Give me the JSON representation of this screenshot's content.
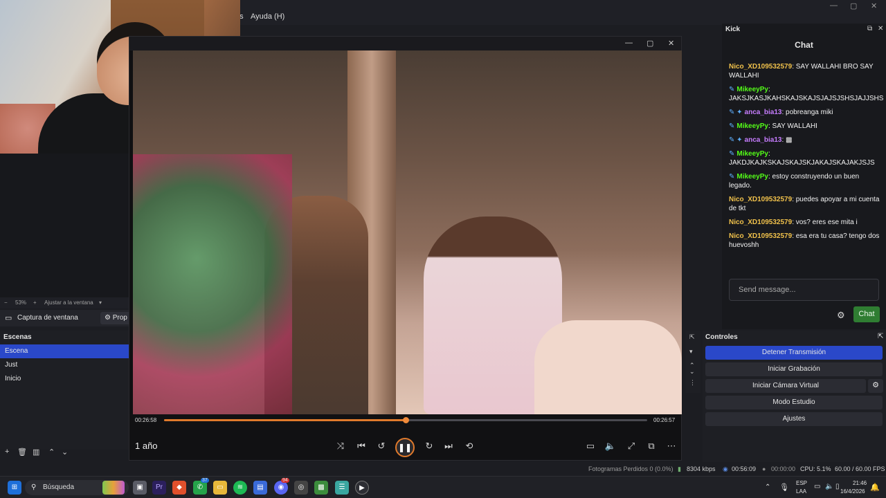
{
  "menubar": {
    "menu_item": "Ayuda (H)",
    "menu_prefix": "as"
  },
  "obs": {
    "zoom": "53%",
    "fit_label": "Ajustar a la ventana",
    "source_label": "Captura de ventana",
    "props_label": "Prop",
    "scenes_header": "Escenas",
    "scenes": [
      "Escena",
      "Just",
      "Inicio"
    ],
    "scene_tools": [
      "+",
      "🗑",
      "▥",
      "⌃",
      "⌄"
    ]
  },
  "player": {
    "time_current": "00:26:58",
    "time_total": "00:26:57",
    "progress": 0.5,
    "age_label": "1 año",
    "controls": [
      "shuffle-icon",
      "previous-icon",
      "rewind-icon",
      "pause-icon",
      "forward-icon",
      "next-icon",
      "repeat-off-icon"
    ],
    "right_controls": [
      "miniplayer-icon",
      "volume-icon",
      "expand-icon",
      "popout-icon",
      "more-icon"
    ]
  },
  "chat": {
    "dock_title": "Kick",
    "title": "Chat",
    "messages": [
      {
        "user": "Nico_XD109532579",
        "color": "#f0c14b",
        "text": "SAY WALLAHI BRO SAY WALLAHI",
        "badges": ""
      },
      {
        "user": "MikeeyPy",
        "color": "#53fc18",
        "text": "JAKSJKASJKAHSKAJSKAJSJAJSJSHSJAJJSHS",
        "badges": "✎"
      },
      {
        "user": "anca_bia13",
        "color": "#c77dff",
        "text": "pobreanga miki",
        "badges": "✎ ✦"
      },
      {
        "user": "MikeeyPy",
        "color": "#53fc18",
        "text": "SAY WALLAHI",
        "badges": "✎"
      },
      {
        "user": "anca_bia13",
        "color": "#c77dff",
        "text": "▩",
        "badges": "✎ ✦"
      },
      {
        "user": "MikeeyPy",
        "color": "#53fc18",
        "text": "JAKDJKAJKSKAJSKAJSKJAKAJSKAJAKJSJS",
        "badges": "✎"
      },
      {
        "user": "MikeeyPy",
        "color": "#53fc18",
        "text": "estoy construyendo un buen legado.",
        "badges": "✎"
      },
      {
        "user": "Nico_XD109532579",
        "color": "#f0c14b",
        "text": "puedes apoyar a mi cuenta de tkt",
        "badges": ""
      },
      {
        "user": "Nico_XD109532579",
        "color": "#f0c14b",
        "text": "vos? eres ese mita i",
        "badges": ""
      },
      {
        "user": "Nico_XD109532579",
        "color": "#f0c14b",
        "text": "esa era tu casa? tengo dos huevoshh",
        "badges": ""
      }
    ],
    "input_placeholder": "Send message...",
    "send_label": "Chat"
  },
  "controles": {
    "header": "Controles",
    "stop_stream": "Detener Transmisión",
    "start_rec": "Iniciar Grabación",
    "virtual_cam": "Iniciar Cámara Virtual",
    "studio": "Modo Estudio",
    "settings": "Ajustes"
  },
  "status": {
    "dropped": "Fotogramas Perdidos 0 (0.0%)",
    "bitrate": "8304 kbps",
    "stream_time": "00:56:09",
    "rec_time": "00:00:00",
    "cpu": "CPU: 5.1%",
    "fps": "60.00 / 60.00 FPS"
  },
  "taskbar": {
    "search": "Búsqueda",
    "lang_top": "ESP",
    "lang_bottom": "LAA",
    "time": "21:46",
    "date": "16/4/2026",
    "badges": {
      "whatsapp": "37",
      "discord": "94"
    }
  },
  "colors": {
    "accent": "#2a48c9",
    "progress": "#e07a2c",
    "send": "#2f7d32"
  }
}
